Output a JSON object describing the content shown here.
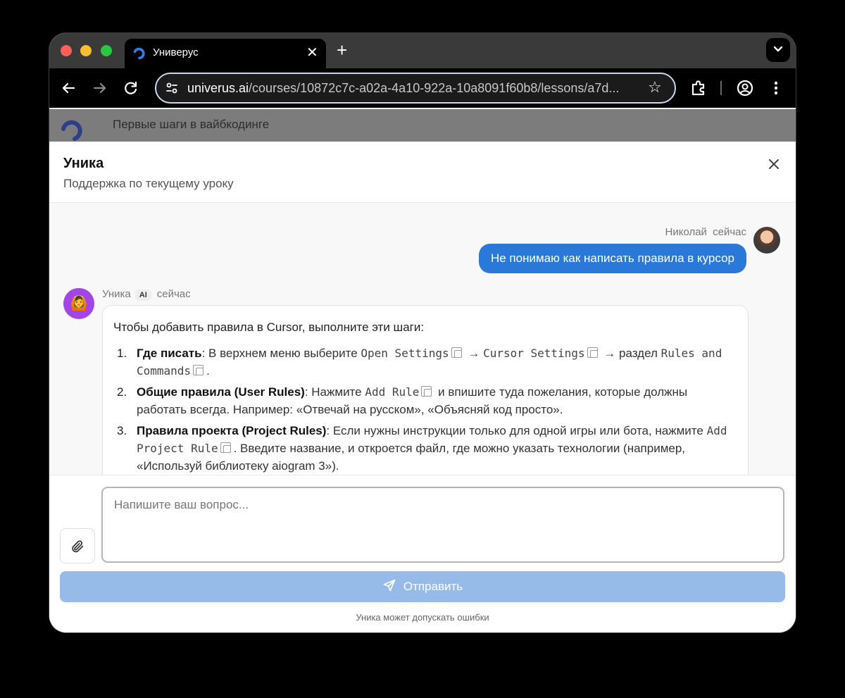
{
  "browser": {
    "tab_title": "Универус",
    "tab_close": "✕",
    "new_tab": "+",
    "url_host": "univerus.ai",
    "url_path": "/courses/10872c7c-a02a-4a10-922a-10a8091f60b8/lessons/a7d..."
  },
  "page": {
    "course_title": "Первые шаги в вайбкодинге"
  },
  "chat": {
    "title": "Уника",
    "subtitle": "Поддержка по текущему уроку",
    "user_message": {
      "author": "Николай",
      "time": "сейчас",
      "text": "Не понимаю как написать правила в курсор"
    },
    "bot_message": {
      "author": "Уника",
      "badge": "AI",
      "time": "сейчас",
      "avatar_emoji": "🙆",
      "intro": "Чтобы добавить правила в Cursor, выполните эти шаги:",
      "steps": [
        {
          "num": "1.",
          "title": "Где писать",
          "t1": ": В верхнем меню выберите ",
          "c1": "Open Settings",
          "t2": " → ",
          "c2": "Cursor Settings",
          "t3": " → раздел ",
          "c3": "Rules and Commands",
          "t4": "."
        },
        {
          "num": "2.",
          "title": "Общие правила (User Rules)",
          "t1": ": Нажмите ",
          "c1": "Add Rule",
          "t2": " и впишите туда пожелания, которые должны работать всегда. Например: «Отвечай на русском», «Объясняй код просто»."
        },
        {
          "num": "3.",
          "title": "Правила проекта (Project Rules)",
          "t1": ": Если нужны инструкции только для одной игры или бота, нажмите ",
          "c1": "Add Project Rule",
          "t2": ". Введите название, и откроется файл, где можно указать технологии (например, «Используй библиотеку aiogram 3»)."
        }
      ]
    },
    "input_placeholder": "Напишите ваш вопрос...",
    "send_label": "Отправить",
    "disclaimer": "Уника может допускать ошибки"
  },
  "icons": {
    "brand_color": "#2a79d8",
    "send_button_color": "#97bbe8",
    "bot_avatar_color": "#a245e6"
  }
}
